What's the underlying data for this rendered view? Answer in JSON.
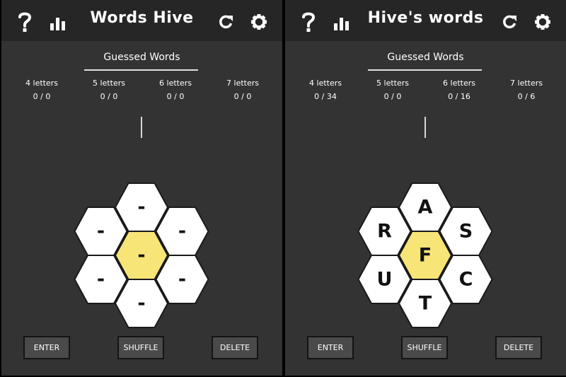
{
  "colors": {
    "panel": "#333333",
    "header": "#262626",
    "hex": "#ffffff",
    "center_hex": "#f8e577",
    "button": "#4a4a4a"
  },
  "header_icons": [
    "help-icon",
    "stats-icon",
    "refresh-icon",
    "settings-icon"
  ],
  "left": {
    "title": "Words Hive",
    "guessed_title": "Guessed Words",
    "columns": [
      {
        "label": "4 letters",
        "count": "0 / 0"
      },
      {
        "label": "5 letters",
        "count": "0 / 0"
      },
      {
        "label": "6 letters",
        "count": "0 / 0"
      },
      {
        "label": "7 letters",
        "count": "0 / 0"
      }
    ],
    "hive": {
      "top": "-",
      "upper_left": "-",
      "upper_right": "-",
      "center": "-",
      "lower_left": "-",
      "lower_right": "-",
      "bottom": "-"
    },
    "buttons": {
      "enter": "ENTER",
      "shuffle": "SHUFFLE",
      "delete": "DELETE"
    }
  },
  "right": {
    "title": "Hive's words",
    "guessed_title": "Guessed Words",
    "columns": [
      {
        "label": "4 letters",
        "count": "0 / 34"
      },
      {
        "label": "5 letters",
        "count": "0 / 0"
      },
      {
        "label": "6 letters",
        "count": "0 / 16"
      },
      {
        "label": "7 letters",
        "count": "0 / 6"
      }
    ],
    "hive": {
      "top": "A",
      "upper_left": "R",
      "upper_right": "S",
      "center": "F",
      "lower_left": "U",
      "lower_right": "C",
      "bottom": "T"
    },
    "buttons": {
      "enter": "ENTER",
      "shuffle": "SHUFFLE",
      "delete": "DELETE"
    }
  }
}
